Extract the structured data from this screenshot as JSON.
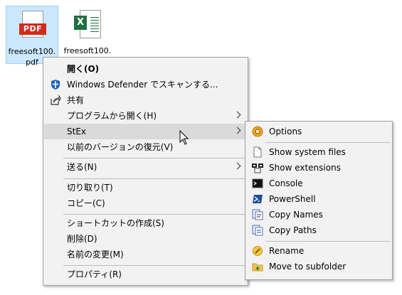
{
  "desktop": {
    "files": [
      {
        "name": "freesoft100.\npdf",
        "icon": "pdf-file-icon",
        "badge": "PDF"
      },
      {
        "name": "freesoft100.",
        "icon": "excel-file-icon",
        "badge": "X"
      }
    ]
  },
  "context_menu": {
    "items": [
      {
        "label": "開く(O)"
      },
      {
        "label": "Windows Defender でスキャンする...",
        "icon": "shield-icon"
      },
      {
        "label": "共有",
        "icon": "share-icon"
      },
      {
        "label": "プログラムから開く(H)"
      },
      {
        "label": "StEx"
      },
      {
        "label": "以前のバージョンの復元(V)"
      },
      {
        "label": "送る(N)"
      },
      {
        "label": "切り取り(T)"
      },
      {
        "label": "コピー(C)"
      },
      {
        "label": "ショートカットの作成(S)"
      },
      {
        "label": "削除(D)"
      },
      {
        "label": "名前の変更(M)"
      },
      {
        "label": "プロパティ(R)"
      }
    ]
  },
  "submenu": {
    "items": [
      {
        "label": "Options",
        "icon": "options-gear-icon"
      },
      {
        "label": "Show system files",
        "icon": "system-file-icon"
      },
      {
        "label": "Show extensions",
        "icon": "extensions-icon"
      },
      {
        "label": "Console",
        "icon": "console-icon"
      },
      {
        "label": "PowerShell",
        "icon": "powershell-icon"
      },
      {
        "label": "Copy Names",
        "icon": "copy-names-icon"
      },
      {
        "label": "Copy Paths",
        "icon": "copy-paths-icon"
      },
      {
        "label": "Rename",
        "icon": "rename-icon"
      },
      {
        "label": "Move to subfolder",
        "icon": "move-folder-icon"
      }
    ]
  },
  "colors": {
    "menu_bg": "#f2f2f2",
    "hover_bg": "#dadada",
    "selection_bg": "#cce8ff",
    "pdf_red": "#d42a1e",
    "excel_green": "#1d6f42"
  }
}
